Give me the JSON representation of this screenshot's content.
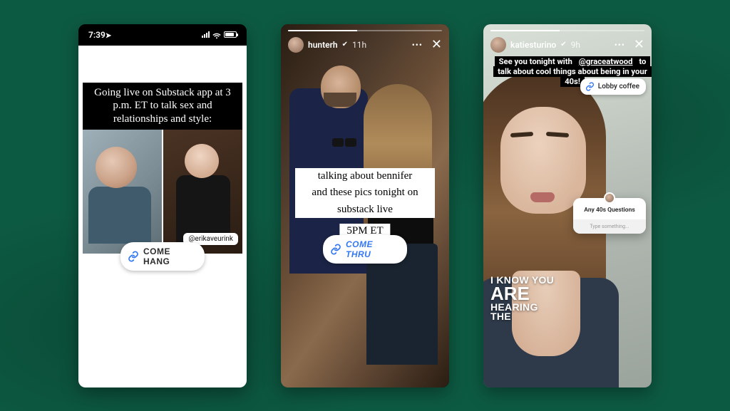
{
  "phone1": {
    "statusbar": {
      "time": "7:39"
    },
    "banner": "Going live on Substack app at 3 p.m. ET to talk sex and relationships and style:",
    "tag_handle": "@erikaveurink",
    "link_label": "COME HANG"
  },
  "phone2": {
    "header": {
      "username": "hunterh",
      "time_ago": "11h"
    },
    "text_lines": [
      "talking about bennifer",
      "and these pics tonight on",
      "substack live"
    ],
    "time_label": "5PM ET",
    "link_label": "COME THRU"
  },
  "phone3": {
    "header": {
      "username": "katiesturino",
      "time_ago": "9h"
    },
    "top_text": {
      "pre": "See you tonight with ",
      "mention": "@graceatwood",
      "post": " to talk about cool things about being in your 40s!"
    },
    "lobby_label": "Lobby coffee",
    "question": {
      "title": "Any 40s Questions",
      "placeholder": "Type something..."
    },
    "caption": {
      "l1": "I KNOW YOU",
      "l2": "ARE",
      "l3": "HEARING",
      "l4": "THE"
    }
  }
}
